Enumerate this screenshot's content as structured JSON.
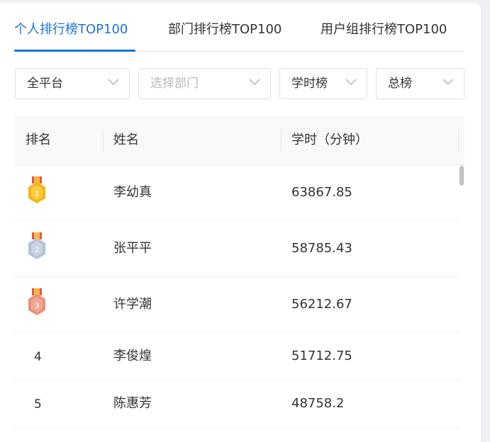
{
  "tabs": [
    {
      "label": "个人排行榜TOP100",
      "active": true
    },
    {
      "label": "部门排行榜TOP100",
      "active": false
    },
    {
      "label": "用户组排行榜TOP100",
      "active": false
    }
  ],
  "filters": {
    "platform": {
      "value": "全平台"
    },
    "department": {
      "placeholder": "选择部门"
    },
    "metric": {
      "value": "学时榜"
    },
    "period": {
      "value": "总榜"
    }
  },
  "table": {
    "columns": [
      "排名",
      "姓名",
      "学时（分钟）"
    ],
    "rows": [
      {
        "rank": "1",
        "name": "李幼真",
        "hours": "63867.85",
        "medal": "gold"
      },
      {
        "rank": "2",
        "name": "张平平",
        "hours": "58785.43",
        "medal": "silver"
      },
      {
        "rank": "3",
        "name": "许学潮",
        "hours": "56212.67",
        "medal": "bronze"
      },
      {
        "rank": "4",
        "name": "李俊煌",
        "hours": "51712.75",
        "medal": null
      },
      {
        "rank": "5",
        "name": "陈惠芳",
        "hours": "48758.2",
        "medal": null
      }
    ]
  },
  "colors": {
    "accent": "#1a73d9",
    "gold": "#f5b417",
    "silver": "#b4c2d8",
    "bronze": "#e8917a"
  }
}
